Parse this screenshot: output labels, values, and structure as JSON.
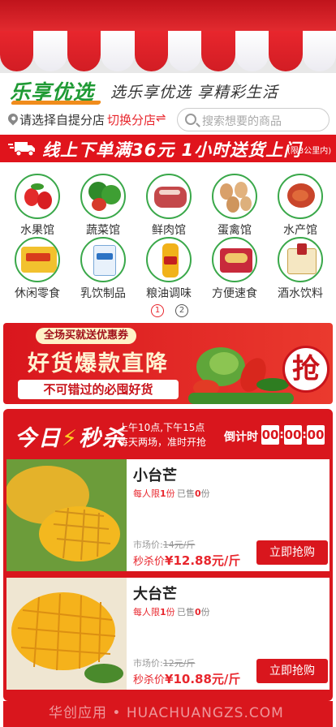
{
  "brand": {
    "logo_text": "乐享优选",
    "slogan": "选乐享优选  享精彩生活"
  },
  "location": {
    "store_prompt": "请选择自提分店",
    "switch_label": "切换分店",
    "switch_icon": "swap-arrows-icon",
    "search_placeholder": "搜索想要的商品"
  },
  "delivery_banner": {
    "text": "线上下单满36元 1小时送货上门",
    "note": "(限3公里内)"
  },
  "categories": [
    {
      "label": "水果馆",
      "icon": "strawberry-icon"
    },
    {
      "label": "蔬菜馆",
      "icon": "broccoli-icon"
    },
    {
      "label": "鲜肉馆",
      "icon": "meat-icon"
    },
    {
      "label": "蛋禽馆",
      "icon": "eggs-icon"
    },
    {
      "label": "水产馆",
      "icon": "crayfish-icon"
    },
    {
      "label": "休闲零食",
      "icon": "snacks-icon"
    },
    {
      "label": "乳饮制品",
      "icon": "milk-icon"
    },
    {
      "label": "粮油调味",
      "icon": "oil-bottle-icon"
    },
    {
      "label": "方便速食",
      "icon": "instant-noodles-icon"
    },
    {
      "label": "酒水饮料",
      "icon": "liquor-icon"
    }
  ],
  "pager": {
    "pages": [
      "1",
      "2"
    ],
    "active": "1"
  },
  "promo": {
    "tag": "全场买就送优惠券",
    "title": "好货爆款直降",
    "subtitle": "不可错过的必囤好货",
    "grab": "抢"
  },
  "flash_sale": {
    "title_a": "今日",
    "title_b": "秒杀",
    "schedule_line1": "上午10点,下午15点",
    "schedule_line2": "每天两场，准时开抢",
    "countdown_label": "倒计时",
    "hours": "00",
    "minutes": "00",
    "seconds": "00",
    "separator": ":"
  },
  "products": [
    {
      "name": "小台芒",
      "limit_prefix": "每人限",
      "limit_count": "1",
      "limit_suffix": "份",
      "sold_prefix": "已售",
      "sold_count": "0",
      "sold_suffix": "份",
      "market_label": "市场价:",
      "market_price": "14元/斤",
      "sale_label": "秒杀价",
      "sale_price": "¥12.88元/斤",
      "buy_label": "立即抢购"
    },
    {
      "name": "大台芒",
      "limit_prefix": "每人限",
      "limit_count": "1",
      "limit_suffix": "份",
      "sold_prefix": "已售",
      "sold_count": "0",
      "sold_suffix": "份",
      "market_label": "市场价:",
      "market_price": "12元/斤",
      "sale_label": "秒杀价",
      "sale_price": "¥10.88元/斤",
      "buy_label": "立即抢购"
    }
  ],
  "watermark": "华创应用 • HUACHUANGZS.COM",
  "colors": {
    "brand_red": "#e0141c",
    "brand_green": "#1f9a34",
    "accent_orange": "#f08c1c"
  }
}
